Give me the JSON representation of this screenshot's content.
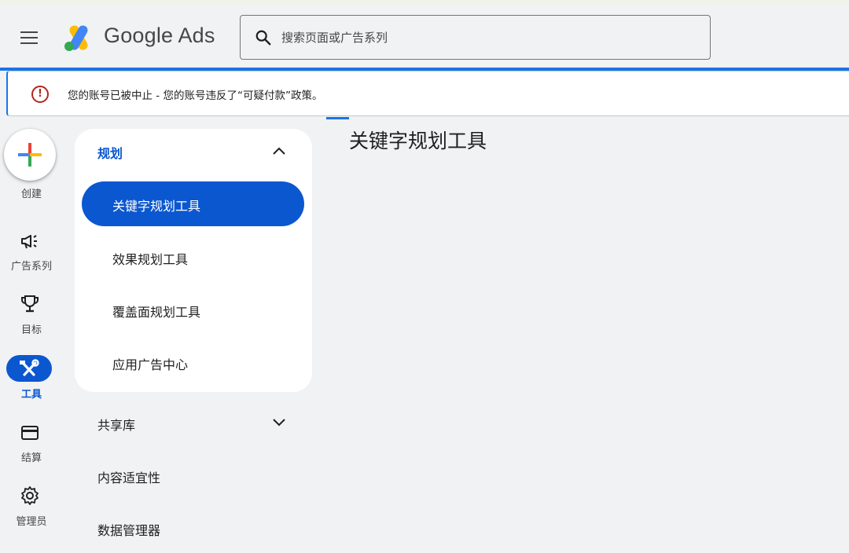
{
  "header": {
    "brand": "Google Ads",
    "search_placeholder": "搜索页面或广告系列"
  },
  "alert": {
    "title": "您的账号已被中止",
    "separator": " - ",
    "message": "您的账号违反了“可疑付款”政策。"
  },
  "rail": {
    "create_label": "创建",
    "items": [
      {
        "label": "广告系列",
        "icon": "megaphone-icon"
      },
      {
        "label": "目标",
        "icon": "trophy-icon"
      },
      {
        "label": "工具",
        "icon": "tools-icon",
        "active": true
      },
      {
        "label": "结算",
        "icon": "credit-card-icon"
      },
      {
        "label": "管理员",
        "icon": "gear-icon"
      }
    ]
  },
  "nav": {
    "section_title": "规划",
    "items": [
      {
        "label": "关键字规划工具",
        "selected": true
      },
      {
        "label": "效果规划工具"
      },
      {
        "label": "覆盖面规划工具"
      },
      {
        "label": "应用广告中心"
      }
    ],
    "other_sections": [
      {
        "label": "共享库",
        "expandable": true
      },
      {
        "label": "内容适宜性"
      },
      {
        "label": "数据管理器"
      }
    ]
  },
  "main": {
    "title": "关键字规划工具"
  },
  "colors": {
    "accent": "#0b57d0",
    "error": "#b3261e",
    "background": "#f0f2f4"
  }
}
